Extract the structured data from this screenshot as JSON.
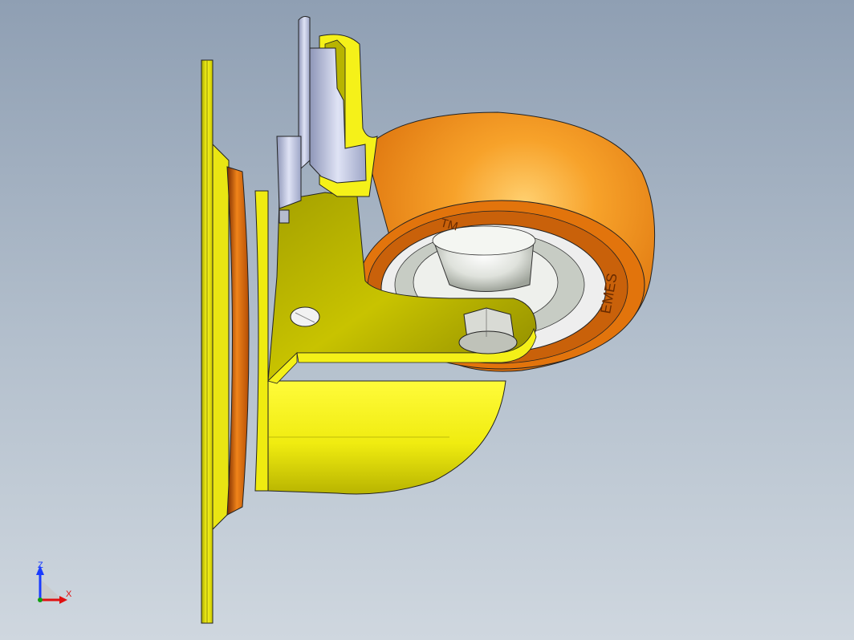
{
  "model": {
    "wheel_text_top": "TM",
    "wheel_text_side": "EMES"
  },
  "triad": {
    "z_label": "Z",
    "x_label": "X",
    "z_color": "#1a3cff",
    "x_color": "#e01010",
    "y_color": "#10a010"
  },
  "colors": {
    "bg_top": "#8f9fb3",
    "bg_bottom": "#cfd7df",
    "bracket": "#f2ee14",
    "bracket_shade": "#8a8a00",
    "wheel_tread": "#f08a12",
    "hub": "#d9ddd8",
    "lock_plate": "#c8cee8"
  }
}
